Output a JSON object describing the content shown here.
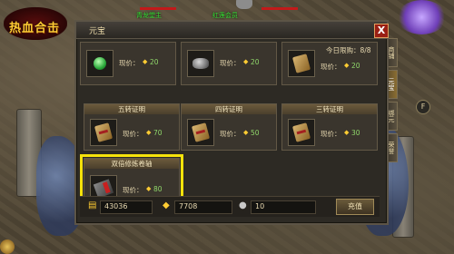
{
  "game": {
    "logo_text": "热血合击"
  },
  "top_status": {
    "left_name": "青龙堂主",
    "right_name": "红莲会员"
  },
  "panel": {
    "title": "元宝",
    "close_label": "X"
  },
  "side_tabs": [
    "商铺",
    "元宝",
    "绑元",
    "荣誉"
  ],
  "side_button": {
    "label": "F"
  },
  "price_label": "现价：",
  "items": [
    {
      "title": "",
      "price": "20",
      "icon": "green-gem-icon",
      "limit": ""
    },
    {
      "title": "",
      "price": "20",
      "icon": "ore-rock-icon",
      "limit": ""
    },
    {
      "title": "",
      "price": "20",
      "icon": "scroll-icon",
      "limit": "今日限购：8/8"
    },
    {
      "title": "五转证明",
      "price": "70",
      "icon": "certificate-scroll-icon",
      "limit": ""
    },
    {
      "title": "四转证明",
      "price": "50",
      "icon": "certificate-scroll-icon",
      "limit": ""
    },
    {
      "title": "三转证明",
      "price": "30",
      "icon": "certificate-scroll-icon",
      "limit": ""
    },
    {
      "title": "双倍修炼卷轴",
      "price": "80",
      "icon": "cultivation-manual-icon",
      "limit": ""
    }
  ],
  "footer": {
    "gold": "43036",
    "yuanbao": "7708",
    "silver": "10",
    "recharge_label": "充值"
  },
  "colors": {
    "highlight": "#f5e20b",
    "price": "#8fd66a",
    "coin": "#ffcc33"
  }
}
